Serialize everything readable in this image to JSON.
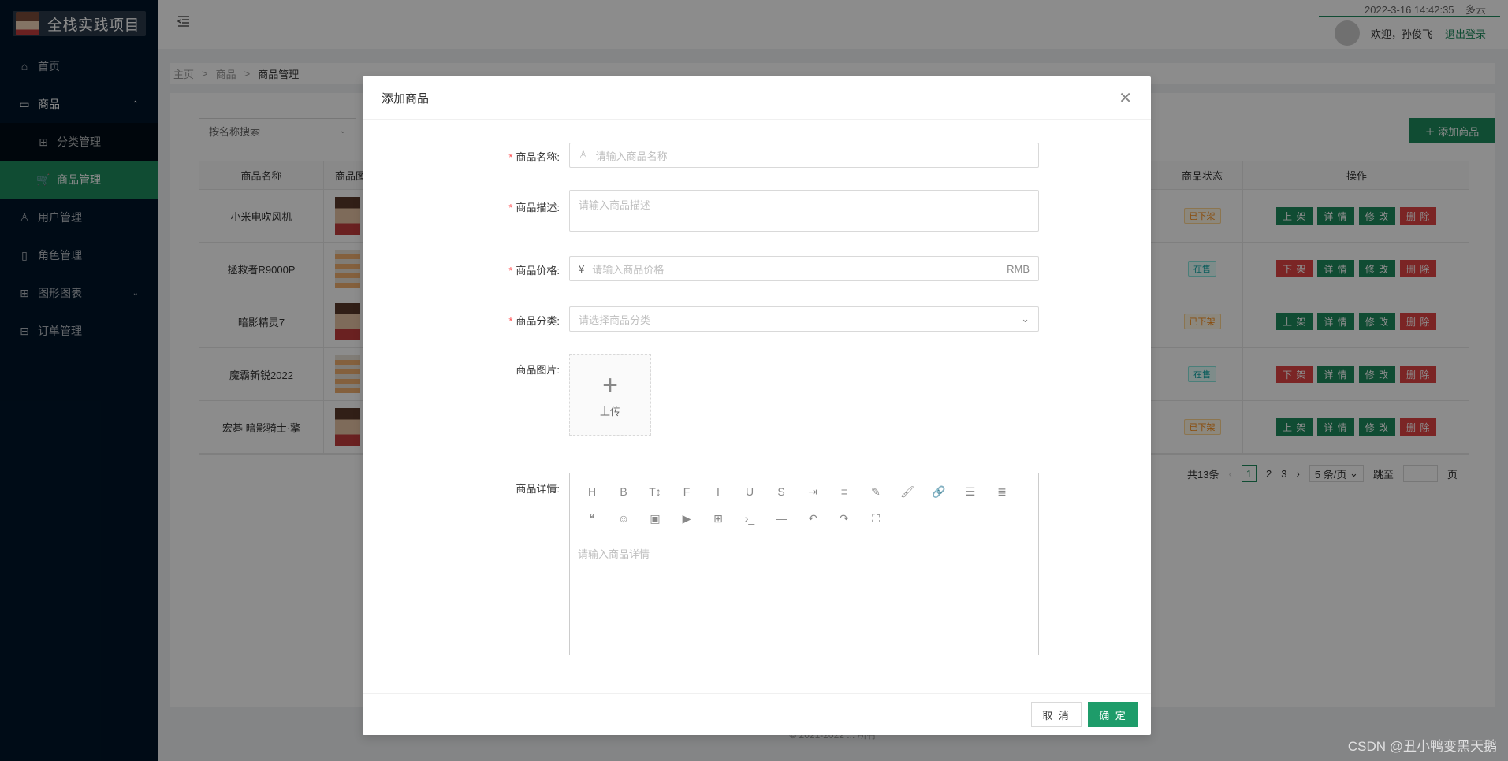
{
  "app": {
    "title": "全栈实践项目"
  },
  "header": {
    "datetime": "2022-3-16 14:42:35",
    "weather": "多云",
    "welcome": "欢迎，孙俊飞",
    "logout": "退出登录"
  },
  "sidebar": {
    "items": [
      {
        "label": "首页",
        "icon": "home-icon"
      },
      {
        "label": "商品",
        "icon": "product-icon",
        "arrow": "⌃"
      },
      {
        "label": "分类管理",
        "icon": "table-icon"
      },
      {
        "label": "商品管理",
        "icon": "cart-icon"
      },
      {
        "label": "用户管理",
        "icon": "user-icon"
      },
      {
        "label": "角色管理",
        "icon": "role-icon"
      },
      {
        "label": "图形图表",
        "icon": "chart-icon",
        "arrow": "⌄"
      },
      {
        "label": "订单管理",
        "icon": "order-icon"
      }
    ]
  },
  "breadcrumb": [
    "主页",
    ">",
    "商品",
    ">",
    "商品管理"
  ],
  "toolbar": {
    "search_select": "按名称搜索",
    "add_button": "添加商品"
  },
  "table": {
    "headers": {
      "name": "商品名称",
      "image": "商品图",
      "status": "商品状态",
      "ops": "操作"
    },
    "rows": [
      {
        "name": "小米电吹风机",
        "status": "已下架",
        "status_kind": "off",
        "toggle": "上 架"
      },
      {
        "name": "拯救者R9000P",
        "status": "在售",
        "status_kind": "on",
        "toggle": "下 架"
      },
      {
        "name": "暗影精灵7",
        "status": "已下架",
        "status_kind": "off",
        "toggle": "上 架"
      },
      {
        "name": "魔霸新锐2022",
        "status": "在售",
        "status_kind": "on",
        "toggle": "下 架"
      },
      {
        "name": "宏碁 暗影骑士·擎",
        "status": "已下架",
        "status_kind": "off",
        "toggle": "上 架"
      }
    ],
    "op_detail": "详 情",
    "op_edit": "修 改",
    "op_delete": "删 除"
  },
  "pagination": {
    "total": "共13条",
    "pages": [
      "1",
      "2",
      "3"
    ],
    "page_size": "5 条/页",
    "jump_label": "跳至",
    "page_suffix": "页"
  },
  "footer": {
    "text": "© 2021-2022 ... 所有"
  },
  "watermark": "CSDN @丑小鸭变黑天鹅",
  "modal": {
    "title": "添加商品",
    "fields": {
      "name": {
        "label": "商品名称:",
        "placeholder": "请输入商品名称",
        "required": true
      },
      "desc": {
        "label": "商品描述:",
        "placeholder": "请输入商品描述",
        "required": true
      },
      "price": {
        "label": "商品价格:",
        "placeholder": "请输入商品价格",
        "prefix": "¥",
        "suffix": "RMB",
        "required": true
      },
      "category": {
        "label": "商品分类:",
        "placeholder": "请选择商品分类",
        "required": true
      },
      "image": {
        "label": "商品图片:",
        "upload_text": "上传"
      },
      "detail": {
        "label": "商品详情:",
        "placeholder": "请输入商品详情"
      }
    },
    "editor_toolbar": [
      "H",
      "B",
      "T↕",
      "F",
      "I",
      "U",
      "S",
      "⇥",
      "≡",
      "✎",
      "🖌",
      "🔗",
      "☰",
      "≣",
      "❝",
      "☺",
      "▣",
      "▶",
      "⊞",
      "›_",
      "—",
      "↶",
      "↷",
      "⛶"
    ],
    "cancel": "取 消",
    "ok": "确 定"
  }
}
